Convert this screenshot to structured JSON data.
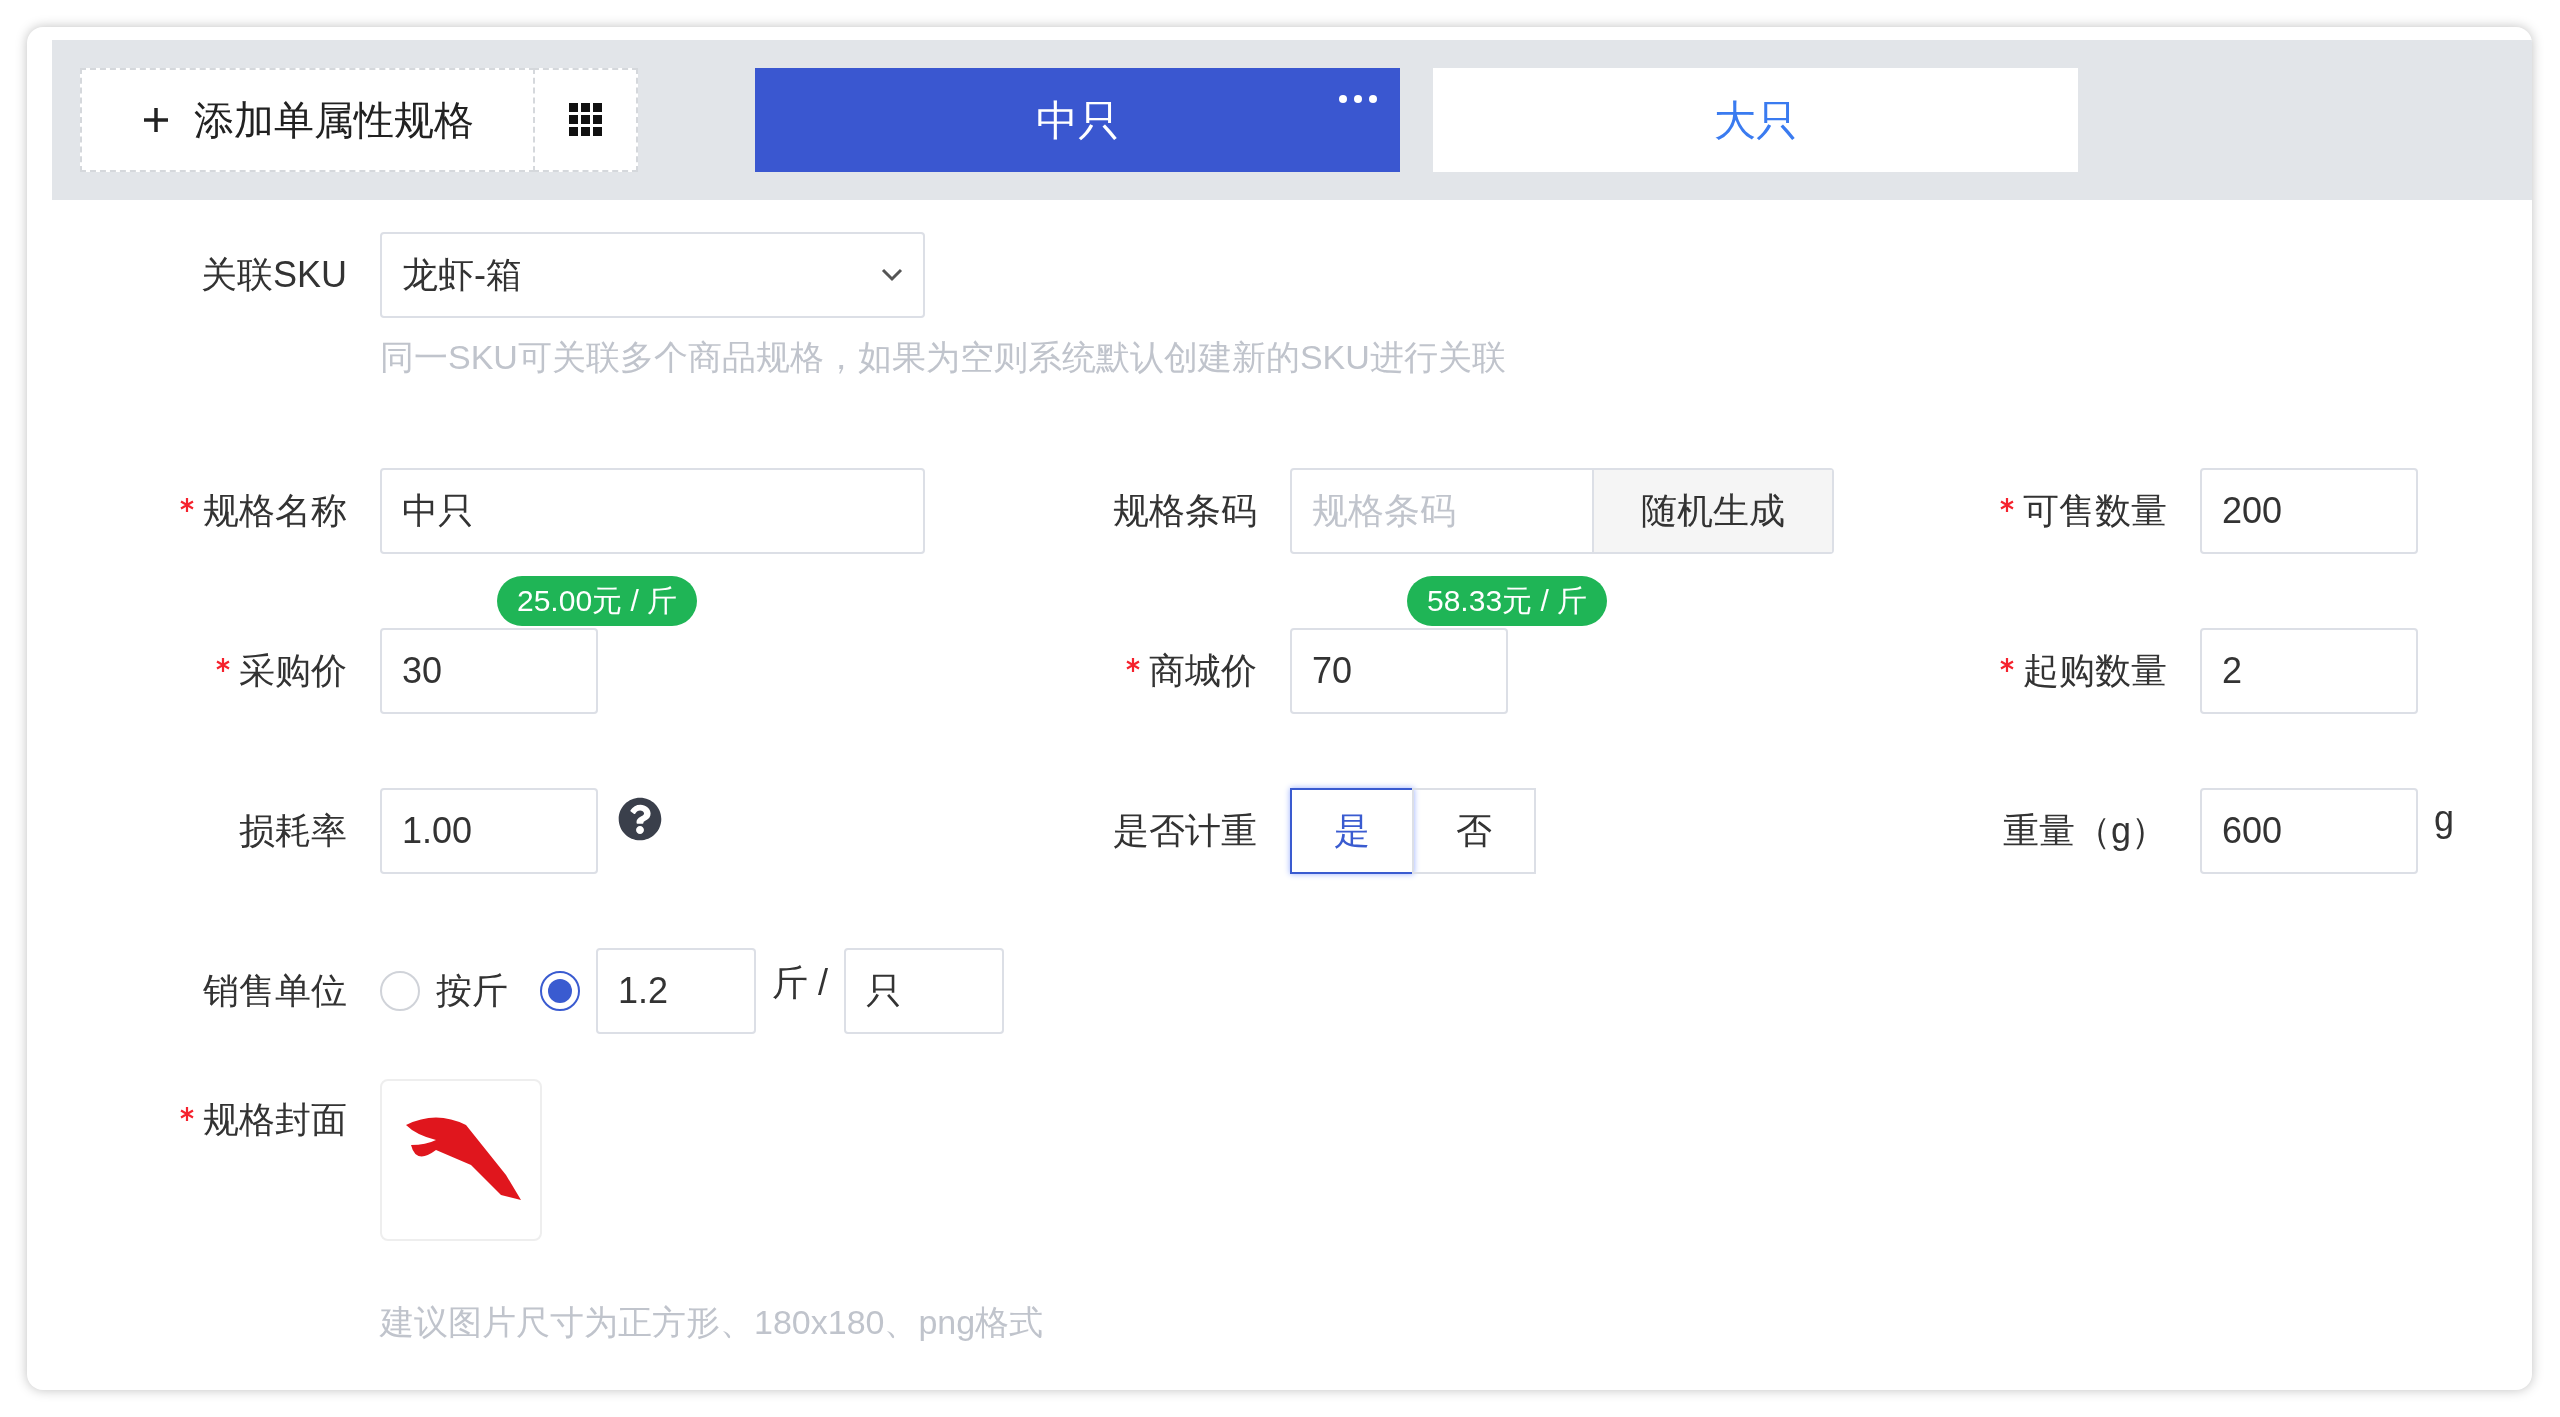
{
  "toolbar": {
    "add_button": "添加单属性规格"
  },
  "tabs": [
    {
      "label": "中只",
      "selected": true
    },
    {
      "label": "大只",
      "selected": false
    }
  ],
  "sku": {
    "label": "关联SKU",
    "value": "龙虾-箱",
    "hint": "同一SKU可关联多个商品规格，如果为空则系统默认创建新的SKU进行关联"
  },
  "rows": [
    [
      {
        "kind": "text",
        "label": "规格名称",
        "required": true,
        "value": "中只"
      },
      {
        "kind": "barcode",
        "label": "规格条码",
        "required": false,
        "placeholder": "规格条码",
        "button": "随机生成"
      },
      {
        "kind": "text",
        "label": "可售数量",
        "required": true,
        "value": "200"
      }
    ],
    [
      {
        "kind": "text",
        "label": "采购价",
        "required": true,
        "value": "30",
        "badge": "25.00元 / 斤"
      },
      {
        "kind": "text",
        "label": "商城价",
        "required": true,
        "value": "70",
        "badge": "58.33元 / 斤"
      },
      {
        "kind": "text",
        "label": "起购数量",
        "required": true,
        "value": "2"
      }
    ],
    [
      {
        "kind": "text",
        "label": "损耗率",
        "required": false,
        "value": "1.00",
        "help": true
      },
      {
        "kind": "toggle",
        "label": "是否计重",
        "required": false,
        "options": [
          {
            "label": "是",
            "selected": true
          },
          {
            "label": "否",
            "selected": false
          }
        ]
      },
      {
        "kind": "text",
        "label": "重量（g）",
        "required": false,
        "value": "600",
        "suffix": "g"
      }
    ]
  ],
  "sales_unit": {
    "label": "销售单位",
    "options": [
      {
        "kind": "plain",
        "label": "按斤",
        "selected": false
      },
      {
        "kind": "custom",
        "selected": true,
        "amount": "1.2",
        "separator": "斤 /",
        "unit": "只"
      }
    ]
  },
  "cover": {
    "label": "规格封面",
    "required": true,
    "hint": "建议图片尺寸为正方形、180x180、png格式"
  }
}
